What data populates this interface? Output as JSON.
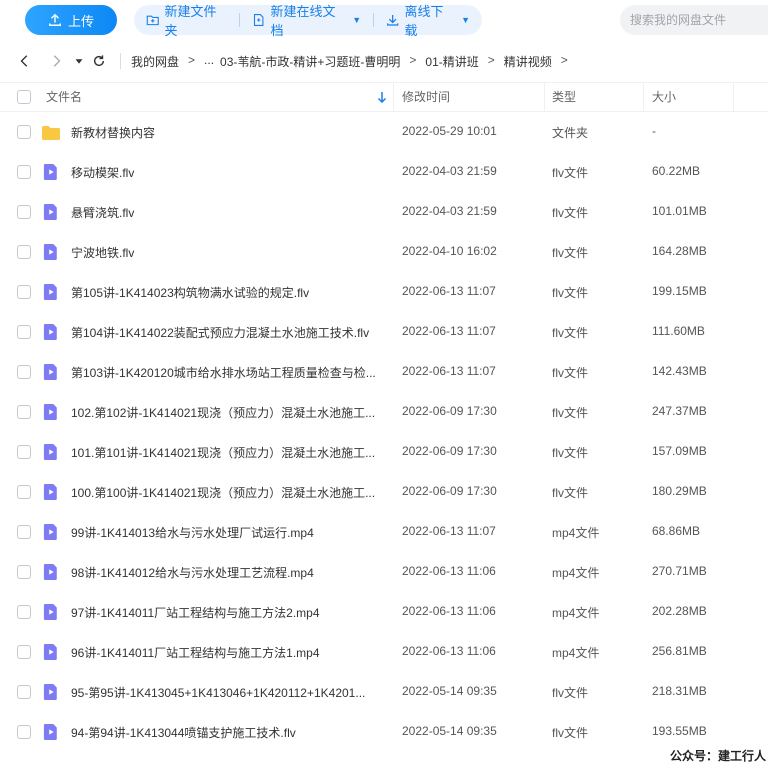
{
  "toolbar": {
    "upload_label": "上传",
    "new_folder_label": "新建文件夹",
    "new_online_doc_label": "新建在线文档",
    "offline_download_label": "离线下载",
    "search_placeholder": "搜索我的网盘文件"
  },
  "breadcrumb": [
    "我的网盘",
    "...",
    "03-苇航-市政-精讲+习题班-曹明明",
    "01-精讲班",
    "精讲视频"
  ],
  "columns": {
    "name": "文件名",
    "modified": "修改时间",
    "type": "类型",
    "size": "大小"
  },
  "colors": {
    "accent": "#1a7fe8",
    "folder": "#f8c843",
    "video_icon": "#7d7cf3"
  },
  "files": [
    {
      "icon": "folder-icon",
      "name": "新教材替换内容",
      "modified": "2022-05-29 10:01",
      "type": "文件夹",
      "size": "-"
    },
    {
      "icon": "video-file-icon",
      "name": "移动模架.flv",
      "modified": "2022-04-03 21:59",
      "type": "flv文件",
      "size": "60.22MB"
    },
    {
      "icon": "video-file-icon",
      "name": "悬臂浇筑.flv",
      "modified": "2022-04-03 21:59",
      "type": "flv文件",
      "size": "101.01MB"
    },
    {
      "icon": "video-file-icon",
      "name": "宁波地铁.flv",
      "modified": "2022-04-10 16:02",
      "type": "flv文件",
      "size": "164.28MB"
    },
    {
      "icon": "video-file-icon",
      "name": "第105讲-1K414023构筑物满水试验的规定.flv",
      "modified": "2022-06-13 11:07",
      "type": "flv文件",
      "size": "199.15MB"
    },
    {
      "icon": "video-file-icon",
      "name": "第104讲-1K414022装配式预应力混凝土水池施工技术.flv",
      "modified": "2022-06-13 11:07",
      "type": "flv文件",
      "size": "111.60MB"
    },
    {
      "icon": "video-file-icon",
      "name": "第103讲-1K420120城市给水排水场站工程质量检查与检...",
      "modified": "2022-06-13 11:07",
      "type": "flv文件",
      "size": "142.43MB"
    },
    {
      "icon": "video-file-icon",
      "name": "102.第102讲-1K414021现浇（预应力）混凝土水池施工...",
      "modified": "2022-06-09 17:30",
      "type": "flv文件",
      "size": "247.37MB"
    },
    {
      "icon": "video-file-icon",
      "name": "101.第101讲-1K414021现浇（预应力）混凝土水池施工...",
      "modified": "2022-06-09 17:30",
      "type": "flv文件",
      "size": "157.09MB"
    },
    {
      "icon": "video-file-icon",
      "name": "100.第100讲-1K414021现浇（预应力）混凝土水池施工...",
      "modified": "2022-06-09 17:30",
      "type": "flv文件",
      "size": "180.29MB"
    },
    {
      "icon": "video-file-icon",
      "name": "99讲-1K414013给水与污水处理厂试运行.mp4",
      "modified": "2022-06-13 11:07",
      "type": "mp4文件",
      "size": "68.86MB"
    },
    {
      "icon": "video-file-icon",
      "name": "98讲-1K414012给水与污水处理工艺流程.mp4",
      "modified": "2022-06-13 11:06",
      "type": "mp4文件",
      "size": "270.71MB"
    },
    {
      "icon": "video-file-icon",
      "name": "97讲-1K414011厂站工程结构与施工方法2.mp4",
      "modified": "2022-06-13 11:06",
      "type": "mp4文件",
      "size": "202.28MB"
    },
    {
      "icon": "video-file-icon",
      "name": "96讲-1K414011厂站工程结构与施工方法1.mp4",
      "modified": "2022-06-13 11:06",
      "type": "mp4文件",
      "size": "256.81MB"
    },
    {
      "icon": "video-file-icon",
      "name": "95-第95讲-1K413045+1K413046+1K420112+1K4201...",
      "modified": "2022-05-14 09:35",
      "type": "flv文件",
      "size": "218.31MB"
    },
    {
      "icon": "video-file-icon",
      "name": "94-第94讲-1K413044喷锚支护施工技术.flv",
      "modified": "2022-05-14 09:35",
      "type": "flv文件",
      "size": "193.55MB"
    }
  ],
  "watermark": "公众号：建工行人"
}
